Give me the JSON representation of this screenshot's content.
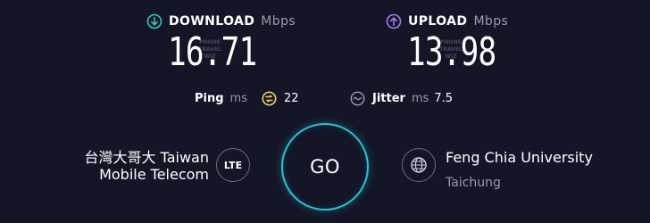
{
  "download": {
    "label": "DOWNLOAD",
    "unit": "Mbps",
    "value": "16.71",
    "icon": "download-arrow-icon",
    "color": "#2ecfb1",
    "watermark": "PHONE TRAVEL WIZ"
  },
  "upload": {
    "label": "UPLOAD",
    "unit": "Mbps",
    "value": "13.98",
    "icon": "upload-arrow-icon",
    "color": "#a879f5",
    "watermark": "PHONE TRAVEL WIZ"
  },
  "ping": {
    "label": "Ping",
    "unit": "ms",
    "value": "22",
    "icon": "ping-icon",
    "color": "#f0d45a"
  },
  "jitter": {
    "label": "Jitter",
    "unit": "ms",
    "value": "7.5",
    "icon": "jitter-icon"
  },
  "provider": {
    "line1": "台灣大哥大 Taiwan",
    "line2": "Mobile Telecom",
    "badge": "LTE"
  },
  "go_button": {
    "label": "GO",
    "color": "#1fc7dc"
  },
  "server": {
    "name": "Feng Chia University",
    "location": "Taichung",
    "icon": "globe-icon"
  }
}
